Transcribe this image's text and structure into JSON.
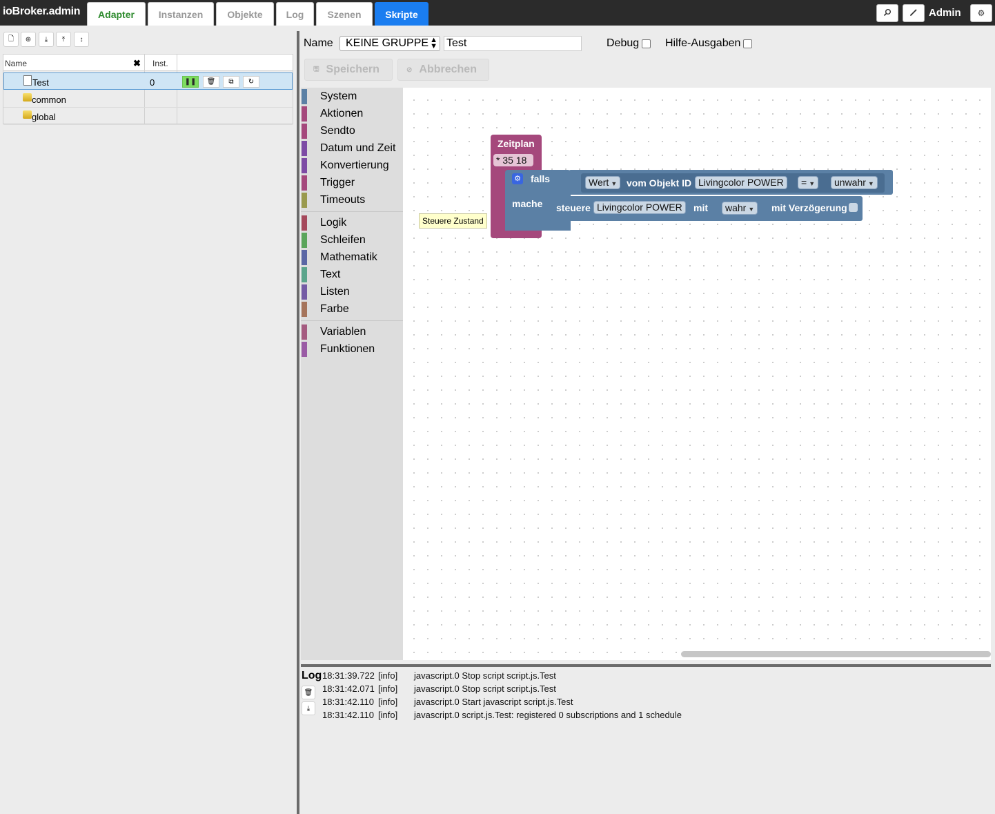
{
  "app": {
    "title": "ioBroker.admin"
  },
  "tabs": [
    {
      "label": "Adapter"
    },
    {
      "label": "Instanzen"
    },
    {
      "label": "Objekte"
    },
    {
      "label": "Log"
    },
    {
      "label": "Szenen"
    },
    {
      "label": "Skripte"
    }
  ],
  "header": {
    "user": "Admin",
    "icons": [
      "search-icon",
      "edit-icon",
      "gear-icon"
    ]
  },
  "left_toolbar": {
    "icons": [
      "new-file-icon",
      "add-folder-icon",
      "export-icon",
      "import-icon",
      "expand-collapse-icon"
    ]
  },
  "tree": {
    "col_name": "Name",
    "clear_glyph": "✖",
    "col_inst": "Inst.",
    "rows": [
      {
        "label": "Test",
        "inst": "0",
        "type": "script",
        "selected": true
      },
      {
        "label": "common",
        "inst": "",
        "type": "folder"
      },
      {
        "label": "global",
        "inst": "",
        "type": "folder"
      }
    ]
  },
  "editor": {
    "name_label": "Name",
    "group_value": "KEINE GRUPPE",
    "name_value": "Test",
    "debug_label": "Debug",
    "hilfe_label": "Hilfe-Ausgaben",
    "save_label": "Speichern",
    "cancel_label": "Abbrechen"
  },
  "toolbox": {
    "categories": [
      {
        "label": "System",
        "color": "#5b80a5"
      },
      {
        "label": "Aktionen",
        "color": "#a5487c"
      },
      {
        "label": "Sendto",
        "color": "#a5487c"
      },
      {
        "label": "Datum und Zeit",
        "color": "#7d4ba5"
      },
      {
        "label": "Konvertierung",
        "color": "#7d4ba5"
      },
      {
        "label": "Trigger",
        "color": "#a5487c"
      },
      {
        "label": "Timeouts",
        "color": "#9a9a4e"
      },
      {
        "label": "Logik",
        "color": "#a5485b"
      },
      {
        "label": "Schleifen",
        "color": "#5ba55b"
      },
      {
        "label": "Mathematik",
        "color": "#5b67a5"
      },
      {
        "label": "Text",
        "color": "#5ba58c"
      },
      {
        "label": "Listen",
        "color": "#745ba5"
      },
      {
        "label": "Farbe",
        "color": "#a5745b"
      },
      {
        "label": "Variablen",
        "color": "#a55b80"
      },
      {
        "label": "Funktionen",
        "color": "#9a5ba5"
      }
    ]
  },
  "blocks": {
    "schedule_label": "Zeitplan",
    "schedule_value": "* 35 18",
    "if_label": "falls",
    "do_label": "mache",
    "value_label": "Wert",
    "object_label": "vom Objekt ID",
    "object_id": "Livingcolor POWER",
    "operator": "=",
    "compare_value": "unwahr",
    "set_label": "steuere",
    "set_object": "Livingcolor POWER",
    "with_label": "mit",
    "set_value": "wahr",
    "delay_label": "mit Verzögerung",
    "tooltip": "Steuere Zustand"
  },
  "log": {
    "title": "Log",
    "lines": [
      {
        "time": "18:31:39.722",
        "level": "[info]",
        "message": "javascript.0 Stop script script.js.Test"
      },
      {
        "time": "18:31:42.071",
        "level": "[info]",
        "message": "javascript.0 Stop script script.js.Test"
      },
      {
        "time": "18:31:42.110",
        "level": "[info]",
        "message": "javascript.0 Start javascript script.js.Test"
      },
      {
        "time": "18:31:42.110",
        "level": "[info]",
        "message": "javascript.0 script.js.Test: registered 0 subscriptions and 1 schedule"
      }
    ]
  }
}
